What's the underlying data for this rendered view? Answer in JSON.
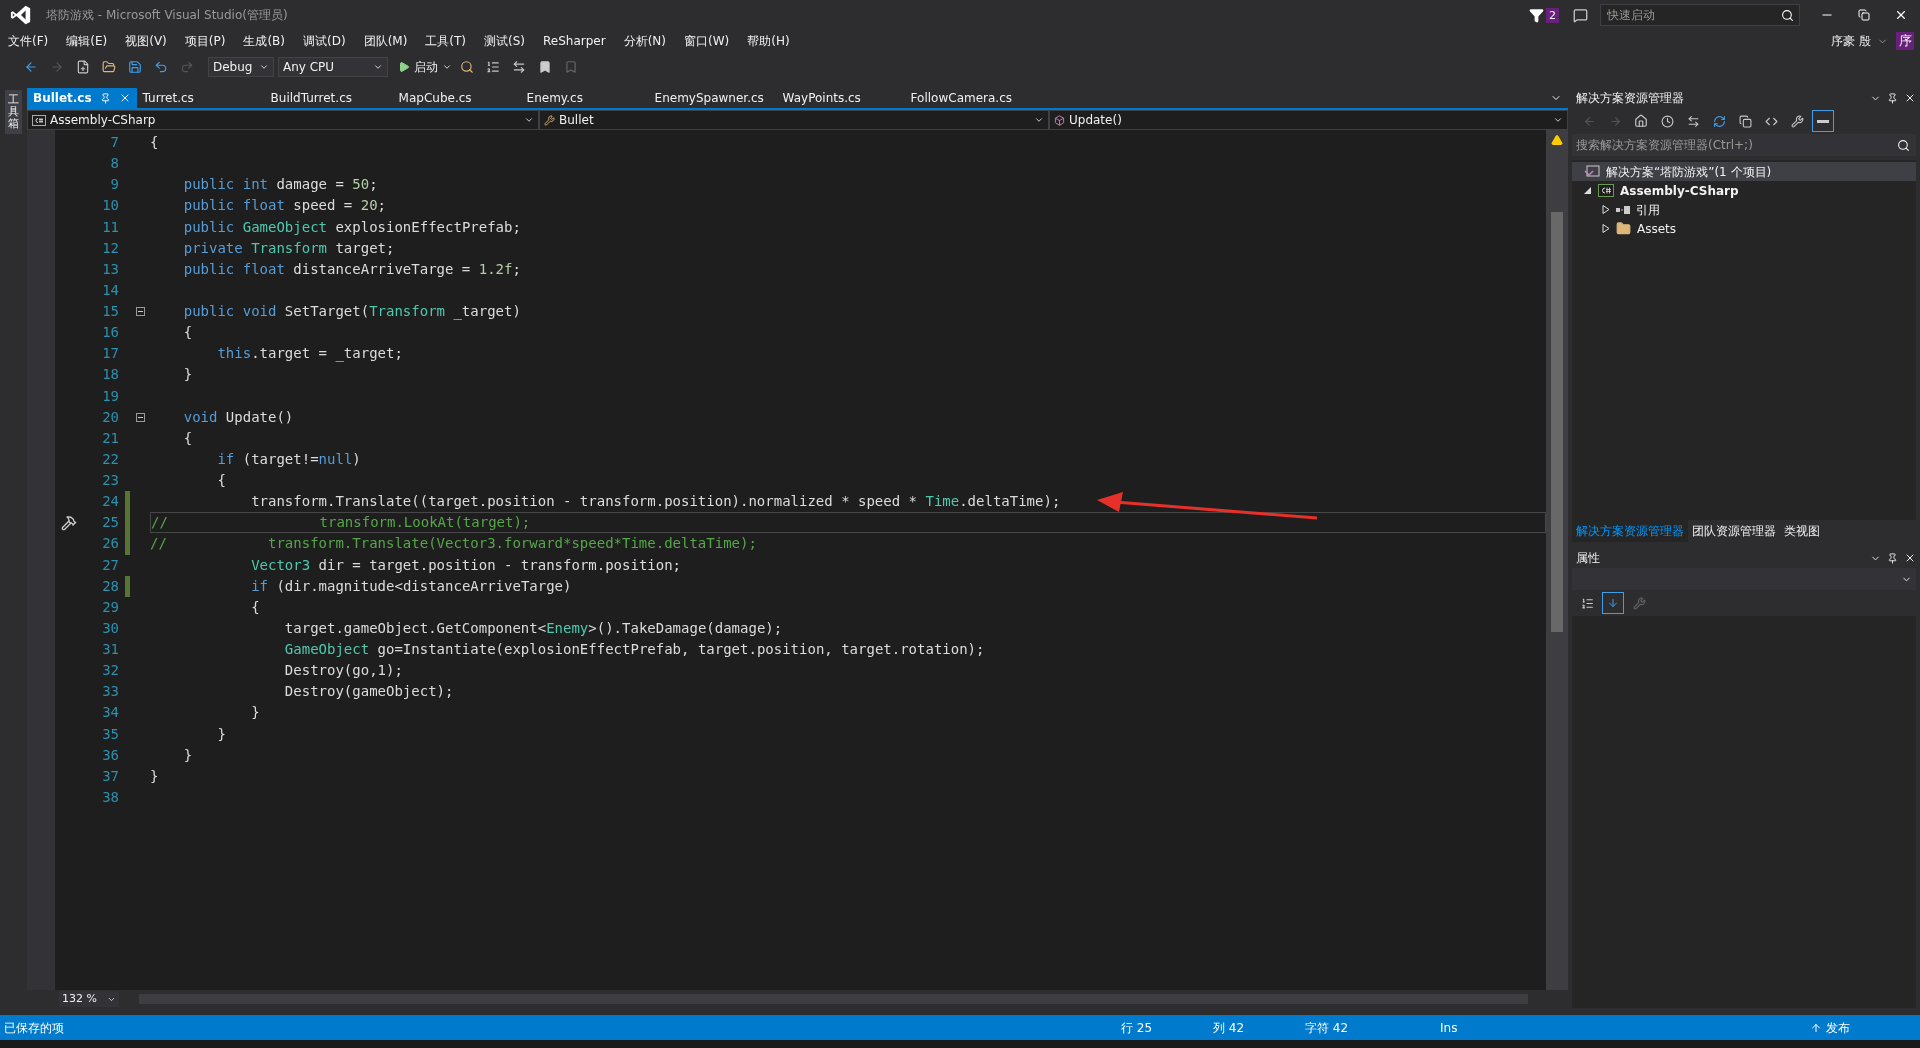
{
  "window": {
    "title": "塔防游戏 - Microsoft Visual Studio(管理员)",
    "notification_count": "2",
    "quick_launch": {
      "placeholder": "快速启动"
    },
    "user": "序豪 殷",
    "avatar": "序"
  },
  "menu": [
    "文件(F)",
    "编辑(E)",
    "视图(V)",
    "项目(P)",
    "生成(B)",
    "调试(D)",
    "团队(M)",
    "工具(T)",
    "测试(S)",
    "ReSharper",
    "分析(N)",
    "窗口(W)",
    "帮助(H)"
  ],
  "toolbar": {
    "configuration": "Debug",
    "platform": "Any CPU",
    "start": "启动"
  },
  "toolbox_tab": "工具箱",
  "tabs": [
    {
      "label": "Bullet.cs",
      "selected": true
    },
    {
      "label": "Turret.cs",
      "selected": false
    },
    {
      "label": "BuildTurret.cs",
      "selected": false
    },
    {
      "label": "MapCube.cs",
      "selected": false
    },
    {
      "label": "Enemy.cs",
      "selected": false
    },
    {
      "label": "EnemySpawner.cs",
      "selected": false
    },
    {
      "label": "WayPoints.cs",
      "selected": false
    },
    {
      "label": "FollowCamera.cs",
      "selected": false
    }
  ],
  "navigation": {
    "project": "Assembly-CSharp",
    "type": "Bullet",
    "member": "Update()"
  },
  "code_lines": [
    {
      "number": "7",
      "changed": false,
      "current": false,
      "fold": false,
      "tokens": [
        {
          "kind": "text",
          "text": "{"
        }
      ]
    },
    {
      "number": "8",
      "changed": false,
      "current": false,
      "fold": false
    },
    {
      "number": "9",
      "changed": false,
      "current": false,
      "fold": false,
      "tokens": [
        {
          "kind": "kw",
          "text": "    public int"
        },
        {
          "kind": "text",
          "text": " damage = "
        },
        {
          "kind": "num",
          "text": "50"
        },
        {
          "kind": "text",
          "text": ";"
        }
      ]
    },
    {
      "number": "10",
      "changed": false,
      "current": false,
      "fold": false,
      "tokens": [
        {
          "kind": "kw",
          "text": "    public float"
        },
        {
          "kind": "text",
          "text": " speed = "
        },
        {
          "kind": "num",
          "text": "20"
        },
        {
          "kind": "text",
          "text": ";"
        }
      ]
    },
    {
      "number": "11",
      "changed": false,
      "current": false,
      "fold": false,
      "tokens": [
        {
          "kind": "kw",
          "text": "    public"
        },
        {
          "kind": "type",
          "text": " GameObject"
        },
        {
          "kind": "text",
          "text": " explosionEffectPrefab;"
        }
      ]
    },
    {
      "number": "12",
      "changed": false,
      "current": false,
      "fold": false,
      "tokens": [
        {
          "kind": "kw",
          "text": "    private"
        },
        {
          "kind": "type",
          "text": " Transform"
        },
        {
          "kind": "text",
          "text": " target;"
        }
      ]
    },
    {
      "number": "13",
      "changed": false,
      "current": false,
      "fold": false,
      "tokens": [
        {
          "kind": "kw",
          "text": "    public float"
        },
        {
          "kind": "text",
          "text": " distanceArriveTarge = "
        },
        {
          "kind": "num",
          "text": "1.2f"
        },
        {
          "kind": "text",
          "text": ";"
        }
      ]
    },
    {
      "number": "14",
      "changed": false,
      "current": false,
      "fold": false
    },
    {
      "number": "15",
      "changed": false,
      "current": false,
      "fold": true,
      "tokens": [
        {
          "kind": "kw",
          "text": "    public void"
        },
        {
          "kind": "text",
          "text": " SetTarget("
        },
        {
          "kind": "type",
          "text": "Transform"
        },
        {
          "kind": "text",
          "text": " _target)"
        }
      ]
    },
    {
      "number": "16",
      "changed": false,
      "current": false,
      "fold": false,
      "tokens": [
        {
          "kind": "text",
          "text": "    {"
        }
      ]
    },
    {
      "number": "17",
      "changed": false,
      "current": false,
      "fold": false,
      "tokens": [
        {
          "kind": "kw",
          "text": "        this"
        },
        {
          "kind": "text",
          "text": ".target = _target;"
        }
      ]
    },
    {
      "number": "18",
      "changed": false,
      "current": false,
      "fold": false,
      "tokens": [
        {
          "kind": "text",
          "text": "    }"
        }
      ]
    },
    {
      "number": "19",
      "changed": false,
      "current": false,
      "fold": false
    },
    {
      "number": "20",
      "changed": false,
      "current": false,
      "fold": true,
      "tokens": [
        {
          "kind": "kw",
          "text": "    void"
        },
        {
          "kind": "text",
          "text": " Update()"
        }
      ]
    },
    {
      "number": "21",
      "changed": false,
      "current": false,
      "fold": false,
      "tokens": [
        {
          "kind": "text",
          "text": "    {"
        }
      ]
    },
    {
      "number": "22",
      "changed": false,
      "current": false,
      "fold": false,
      "tokens": [
        {
          "kind": "kw",
          "text": "        if"
        },
        {
          "kind": "text",
          "text": " (target!="
        },
        {
          "kind": "kw",
          "text": "null"
        },
        {
          "kind": "text",
          "text": ")"
        }
      ]
    },
    {
      "number": "23",
      "changed": false,
      "current": false,
      "fold": false,
      "tokens": [
        {
          "kind": "text",
          "text": "        {"
        }
      ]
    },
    {
      "number": "24",
      "changed": true,
      "current": false,
      "fold": false,
      "tokens": [
        {
          "kind": "text",
          "text": "            transform.Translate((target.position - transform.position).normalized * speed * "
        },
        {
          "kind": "type",
          "text": "Time"
        },
        {
          "kind": "text",
          "text": ".deltaTime);"
        }
      ]
    },
    {
      "number": "25",
      "changed": true,
      "current": true,
      "fold": false,
      "tokens": [
        {
          "kind": "comment",
          "text": "//                  transform.LookAt(target);"
        }
      ]
    },
    {
      "number": "26",
      "changed": true,
      "current": false,
      "fold": false,
      "tokens": [
        {
          "kind": "comment",
          "text": "//            transform.Translate(Vector3.forward*speed*Time.deltaTime);"
        }
      ]
    },
    {
      "number": "27",
      "changed": false,
      "current": false,
      "fold": false,
      "tokens": [
        {
          "kind": "type",
          "text": "            Vector3"
        },
        {
          "kind": "text",
          "text": " dir = target.position - transform.position;"
        }
      ]
    },
    {
      "number": "28",
      "changed": true,
      "current": false,
      "fold": false,
      "tokens": [
        {
          "kind": "kw",
          "text": "            if"
        },
        {
          "kind": "text",
          "text": " (dir.magnitude<distanceArriveTarge)"
        }
      ]
    },
    {
      "number": "29",
      "changed": false,
      "current": false,
      "fold": false,
      "tokens": [
        {
          "kind": "text",
          "text": "            {"
        }
      ]
    },
    {
      "number": "30",
      "changed": false,
      "current": false,
      "fold": false,
      "tokens": [
        {
          "kind": "text",
          "text": "                target.gameObject.GetComponent<"
        },
        {
          "kind": "type",
          "text": "Enemy"
        },
        {
          "kind": "text",
          "text": ">().TakeDamage(damage);"
        }
      ]
    },
    {
      "number": "31",
      "changed": false,
      "current": false,
      "fold": false,
      "tokens": [
        {
          "kind": "type",
          "text": "                GameObject"
        },
        {
          "kind": "text",
          "text": " go=Instantiate(explosionEffectPrefab, target.position, target.rotation);"
        }
      ]
    },
    {
      "number": "32",
      "changed": false,
      "current": false,
      "fold": false,
      "tokens": [
        {
          "kind": "text",
          "text": "                Destroy(go,1);"
        }
      ]
    },
    {
      "number": "33",
      "changed": false,
      "current": false,
      "fold": false,
      "tokens": [
        {
          "kind": "text",
          "text": "                Destroy(gameObject);"
        }
      ]
    },
    {
      "number": "34",
      "changed": false,
      "current": false,
      "fold": false,
      "tokens": [
        {
          "kind": "text",
          "text": "            }"
        }
      ]
    },
    {
      "number": "35",
      "changed": false,
      "current": false,
      "fold": false,
      "tokens": [
        {
          "kind": "text",
          "text": "        }"
        }
      ]
    },
    {
      "number": "36",
      "changed": false,
      "current": false,
      "fold": false,
      "tokens": [
        {
          "kind": "text",
          "text": "    }"
        }
      ]
    },
    {
      "number": "37",
      "changed": false,
      "current": false,
      "fold": false,
      "tokens": [
        {
          "kind": "text",
          "text": "}"
        }
      ]
    },
    {
      "number": "38",
      "changed": false,
      "current": false,
      "fold": false
    }
  ],
  "zoom": "132 %",
  "solution_explorer": {
    "title": "解决方案资源管理器",
    "search": {
      "placeholder": "搜索解决方案资源管理器(Ctrl+;)"
    },
    "tree": [
      {
        "kind": "solution",
        "label": "解决方案“塔防游戏”(1 个项目)",
        "selected": true,
        "children": [
          {
            "kind": "project",
            "label": "Assembly-CSharp",
            "selected": false,
            "expanded": true,
            "children": [
              {
                "kind": "references",
                "label": "引用",
                "selected": false,
                "expanded": false
              },
              {
                "kind": "folder",
                "label": "Assets",
                "selected": false,
                "expanded": false
              }
            ]
          }
        ]
      }
    ]
  },
  "panel_tabs": [
    {
      "label": "解决方案资源管理器",
      "selected": true
    },
    {
      "label": "团队资源管理器",
      "selected": false
    },
    {
      "label": "类视图",
      "selected": false
    }
  ],
  "properties": {
    "title": "属性"
  },
  "status_bar": {
    "message": "已保存的项",
    "line": "行 25",
    "column": "列 42",
    "char": "字符 42",
    "mode": "Ins",
    "publish": "发布"
  }
}
